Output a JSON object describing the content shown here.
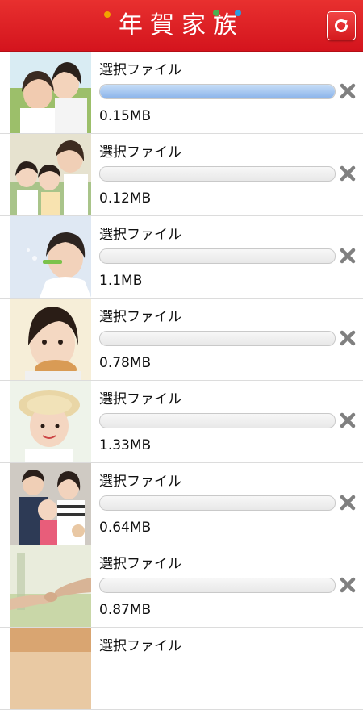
{
  "header": {
    "title": "年賀家族",
    "refresh_icon": "refresh-icon",
    "dot_colors": [
      "#f2a300",
      "#4caf50",
      "#2b9be0"
    ]
  },
  "rows": [
    {
      "label": "選択ファイル",
      "size": "0.15MB",
      "progress": 1.0
    },
    {
      "label": "選択ファイル",
      "size": "0.12MB",
      "progress": 0
    },
    {
      "label": "選択ファイル",
      "size": "1.1MB",
      "progress": 0
    },
    {
      "label": "選択ファイル",
      "size": "0.78MB",
      "progress": 0
    },
    {
      "label": "選択ファイル",
      "size": "1.33MB",
      "progress": 0
    },
    {
      "label": "選択ファイル",
      "size": "0.64MB",
      "progress": 0
    },
    {
      "label": "選択ファイル",
      "size": "0.87MB",
      "progress": 0
    },
    {
      "label": "選択ファイル",
      "size": "",
      "progress": 0
    }
  ],
  "colors": {
    "header_red": "#d9191f",
    "progress_blue": "#8ab3ea",
    "delete_gray": "#808080"
  }
}
